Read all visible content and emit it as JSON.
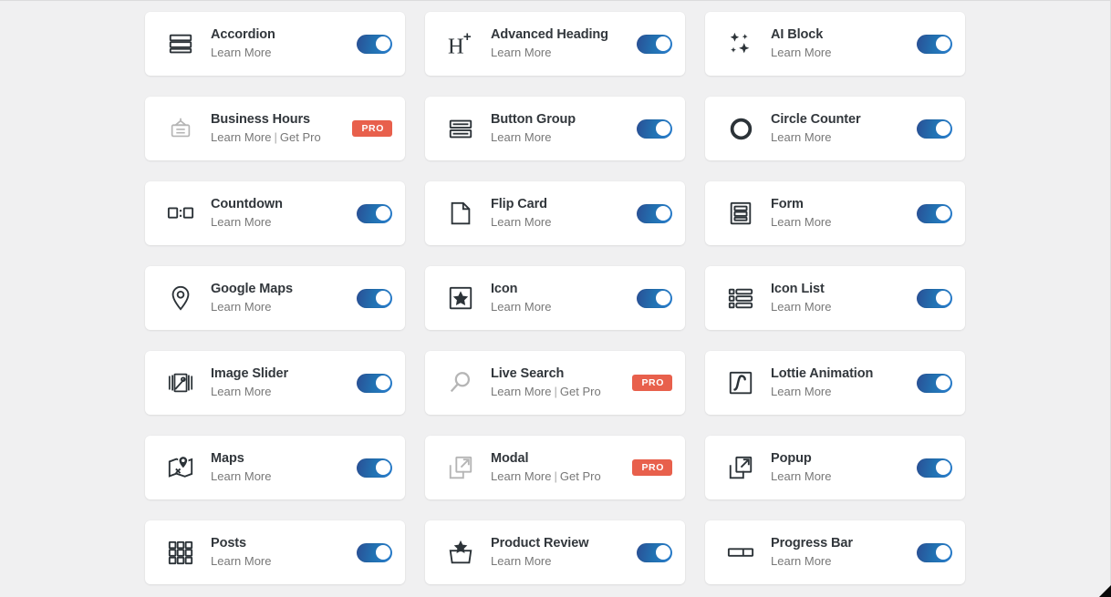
{
  "theme": {
    "background": "#f0f0f1",
    "card_background": "#ffffff",
    "title_color": "#32373c",
    "link_color": "#787878",
    "toggle_on_color": "#2271b1",
    "pro_badge_color": "#e8604c",
    "icon_color": "#2c3338",
    "icon_color_disabled": "#b5b5b5"
  },
  "labels": {
    "learn_more": "Learn More",
    "get_pro": "Get Pro",
    "separator": "|",
    "pro": "PRO"
  },
  "widgets": [
    {
      "id": "accordion",
      "title": "Accordion",
      "icon": "accordion-icon",
      "control": "toggle",
      "enabled": true,
      "links": [
        "Learn More"
      ]
    },
    {
      "id": "advanced-heading",
      "title": "Advanced Heading",
      "icon": "advanced-heading-icon",
      "control": "toggle",
      "enabled": true,
      "links": [
        "Learn More"
      ]
    },
    {
      "id": "ai-block",
      "title": "AI Block",
      "icon": "ai-block-icon",
      "control": "toggle",
      "enabled": true,
      "links": [
        "Learn More"
      ]
    },
    {
      "id": "business-hours",
      "title": "Business Hours",
      "icon": "business-hours-icon",
      "control": "pro",
      "enabled": false,
      "links": [
        "Learn More",
        "Get Pro"
      ]
    },
    {
      "id": "button-group",
      "title": "Button Group",
      "icon": "button-group-icon",
      "control": "toggle",
      "enabled": true,
      "links": [
        "Learn More"
      ]
    },
    {
      "id": "circle-counter",
      "title": "Circle Counter",
      "icon": "circle-counter-icon",
      "control": "toggle",
      "enabled": true,
      "links": [
        "Learn More"
      ]
    },
    {
      "id": "countdown",
      "title": "Countdown",
      "icon": "countdown-icon",
      "control": "toggle",
      "enabled": true,
      "links": [
        "Learn More"
      ]
    },
    {
      "id": "flip-card",
      "title": "Flip Card",
      "icon": "flip-card-icon",
      "control": "toggle",
      "enabled": true,
      "links": [
        "Learn More"
      ]
    },
    {
      "id": "form",
      "title": "Form",
      "icon": "form-icon",
      "control": "toggle",
      "enabled": true,
      "links": [
        "Learn More"
      ]
    },
    {
      "id": "google-maps",
      "title": "Google Maps",
      "icon": "google-maps-icon",
      "control": "toggle",
      "enabled": true,
      "links": [
        "Learn More"
      ]
    },
    {
      "id": "icon",
      "title": "Icon",
      "icon": "icon-icon",
      "control": "toggle",
      "enabled": true,
      "links": [
        "Learn More"
      ]
    },
    {
      "id": "icon-list",
      "title": "Icon List",
      "icon": "icon-list-icon",
      "control": "toggle",
      "enabled": true,
      "links": [
        "Learn More"
      ]
    },
    {
      "id": "image-slider",
      "title": "Image Slider",
      "icon": "image-slider-icon",
      "control": "toggle",
      "enabled": true,
      "links": [
        "Learn More"
      ]
    },
    {
      "id": "live-search",
      "title": "Live Search",
      "icon": "live-search-icon",
      "control": "pro",
      "enabled": false,
      "links": [
        "Learn More",
        "Get Pro"
      ]
    },
    {
      "id": "lottie-animation",
      "title": "Lottie Animation",
      "icon": "lottie-animation-icon",
      "control": "toggle",
      "enabled": true,
      "links": [
        "Learn More"
      ]
    },
    {
      "id": "maps",
      "title": "Maps",
      "icon": "maps-icon",
      "control": "toggle",
      "enabled": true,
      "links": [
        "Learn More"
      ]
    },
    {
      "id": "modal",
      "title": "Modal",
      "icon": "modal-icon",
      "control": "pro",
      "enabled": false,
      "links": [
        "Learn More",
        "Get Pro"
      ]
    },
    {
      "id": "popup",
      "title": "Popup",
      "icon": "popup-icon",
      "control": "toggle",
      "enabled": true,
      "links": [
        "Learn More"
      ]
    },
    {
      "id": "posts",
      "title": "Posts",
      "icon": "posts-icon",
      "control": "toggle",
      "enabled": true,
      "links": [
        "Learn More"
      ]
    },
    {
      "id": "product-review",
      "title": "Product Review",
      "icon": "product-review-icon",
      "control": "toggle",
      "enabled": true,
      "links": [
        "Learn More"
      ]
    },
    {
      "id": "progress-bar",
      "title": "Progress Bar",
      "icon": "progress-bar-icon",
      "control": "toggle",
      "enabled": true,
      "links": [
        "Learn More"
      ]
    }
  ]
}
